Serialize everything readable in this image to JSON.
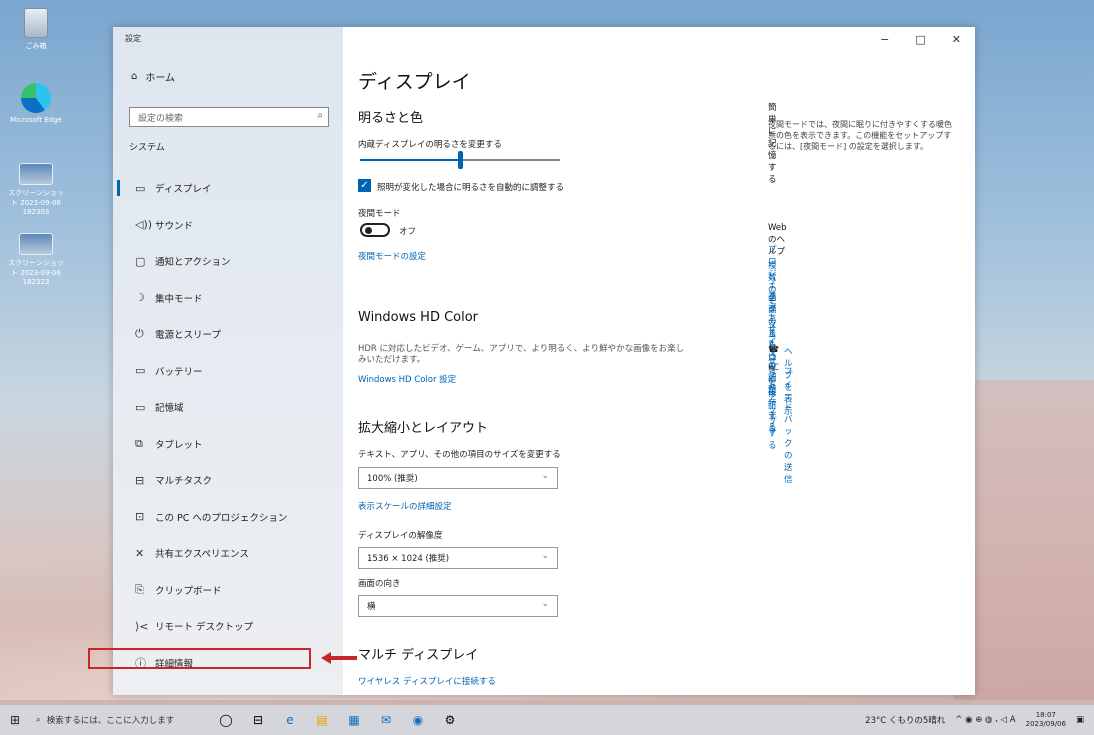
{
  "desktop": {
    "icons": [
      {
        "label": "ごみ箱",
        "name": "recycle-bin-icon"
      },
      {
        "label": "Microsoft Edge",
        "name": "edge-icon"
      },
      {
        "label": "スクリーンショット 2023-09-06 182303",
        "name": "screenshot-file-icon"
      },
      {
        "label": "スクリーンショット 2023-09-06 182323",
        "name": "screenshot-file-icon"
      }
    ]
  },
  "window": {
    "app_title": "設定",
    "controls": {
      "minimize": "−",
      "maximize": "□",
      "close": "✕"
    }
  },
  "nav": {
    "home": {
      "icon": "⌂",
      "label": "ホーム"
    },
    "search_placeholder": "設定の検索",
    "search_icon": "⌕",
    "section": "システム",
    "items": [
      {
        "icon": "▭",
        "label": "ディスプレイ",
        "selected": true
      },
      {
        "icon": "◁))",
        "label": "サウンド"
      },
      {
        "icon": "▢",
        "label": "通知とアクション"
      },
      {
        "icon": "☽",
        "label": "集中モード"
      },
      {
        "icon": "⏻",
        "label": "電源とスリープ"
      },
      {
        "icon": "▭",
        "label": "バッテリー"
      },
      {
        "icon": "▭",
        "label": "記憶域"
      },
      {
        "icon": "⧉",
        "label": "タブレット"
      },
      {
        "icon": "⊟",
        "label": "マルチタスク"
      },
      {
        "icon": "⊡",
        "label": "この PC へのプロジェクション"
      },
      {
        "icon": "✕",
        "label": "共有エクスペリエンス"
      },
      {
        "icon": "⎘",
        "label": "クリップボード"
      },
      {
        "icon": "⟩<",
        "label": "リモート デスクトップ"
      },
      {
        "icon": "ⓘ",
        "label": "詳細情報"
      }
    ]
  },
  "main": {
    "title": "ディスプレイ",
    "brightness": {
      "heading": "明るさと色",
      "slider_label": "内蔵ディスプレイの明るさを変更する",
      "slider_value": 0.5,
      "checkbox_label": "照明が変化した場合に明るさを自動的に調整する",
      "checkbox_checked": true,
      "night_label": "夜間モード",
      "night_state": "オフ",
      "night_settings_link": "夜間モードの設定"
    },
    "hdr": {
      "heading": "Windows HD Color",
      "description": "HDR に対応したビデオ、ゲーム、アプリで、より明るく、より鮮やかな画像をお楽しみいただけます。",
      "link": "Windows HD Color 設定"
    },
    "scale": {
      "heading": "拡大縮小とレイアウト",
      "size_label": "テキスト、アプリ、その他の項目のサイズを変更する",
      "size_value": "100% (推奨)",
      "advanced_link": "表示スケールの詳細設定",
      "resolution_label": "ディスプレイの解像度",
      "resolution_value": "1536 × 1024 (推奨)",
      "orientation_label": "画面の向き",
      "orientation_value": "横"
    },
    "multi": {
      "heading": "マルチ ディスプレイ",
      "wireless_link": "ワイヤレス ディスプレイに接続する"
    }
  },
  "side": {
    "sleep_heading": "簡単に記憶する",
    "sleep_text": "夜間モードでは、夜間に眠りに付きやすくする暖色系の色を表示できます。この機能をセットアップするには、[夜間モード] の設定を選択します。",
    "web_help_heading": "Web のヘルプ",
    "links": [
      "プロジェクターまたは PC に接続する",
      "複数のモニターをセットアップする",
      "フォント サイズの調整",
      "画面のちらつきを修正する"
    ],
    "help_icon": "☎",
    "help_link": "ヘルプを表示",
    "feedback_icon": "✎",
    "feedback_link": "フィードバックの送信"
  },
  "taskbar": {
    "start_icon": "⊞",
    "search_icon": "⌕",
    "search_text": "検索するには、ここに入力します",
    "apps": [
      "◯",
      "⊟",
      "e",
      "▤",
      "▦",
      "✉",
      "◉",
      "⚙"
    ],
    "weather": "23°C くもりの5晴れ",
    "tray_icons": "^ ◉ ⊕ ◍ 𝆺 ◁ A",
    "time": "18:07",
    "date": "2023/09/06",
    "notify_icon": "▣"
  },
  "colors": {
    "accent": "#0063b1",
    "annotation": "#c62828"
  }
}
